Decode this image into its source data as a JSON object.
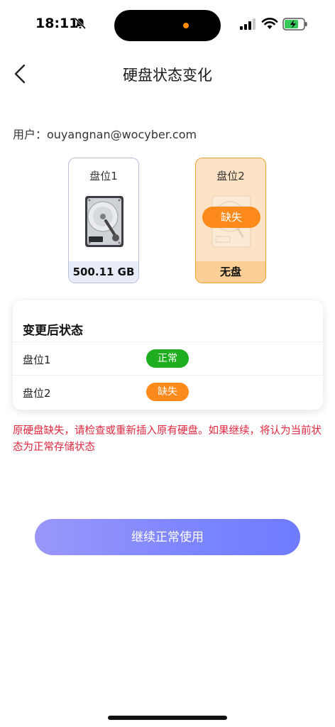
{
  "status_bar": {
    "time": "18:11",
    "icons": [
      "bell-muted-icon",
      "cellular-signal-icon",
      "wifi-icon",
      "battery-charging-icon"
    ],
    "island_dot_color": "#ff8a00",
    "battery_color": "#34c759"
  },
  "header": {
    "back_icon": "chevron-left-icon",
    "title": "硬盘状态变化"
  },
  "user": {
    "label": "用户：ouyangnan@wocyber.com"
  },
  "slots": [
    {
      "name": "盘位1",
      "footer": "500.11 GB",
      "icon": "hard-drive-icon"
    },
    {
      "name": "盘位2",
      "footer": "无盘",
      "badge": "缺失",
      "icon": "hard-drive-icon"
    }
  ],
  "status_panel": {
    "title": "变更后状态",
    "rows": [
      {
        "label": "盘位1",
        "status": "正常",
        "color": "#1fae1f"
      },
      {
        "label": "盘位2",
        "status": "缺失",
        "color": "#ff8a1c"
      }
    ]
  },
  "warning": "原硬盘缺失，请检查或重新插入原有硬盘。如果继续，将认为当前状态为正常存储状态",
  "primary_button": {
    "label": "继续正常使用"
  },
  "colors": {
    "accent": "#7c85ff",
    "warning_text": "#e0273d",
    "ok": "#1fae1f",
    "missing": "#ff8a1c"
  }
}
